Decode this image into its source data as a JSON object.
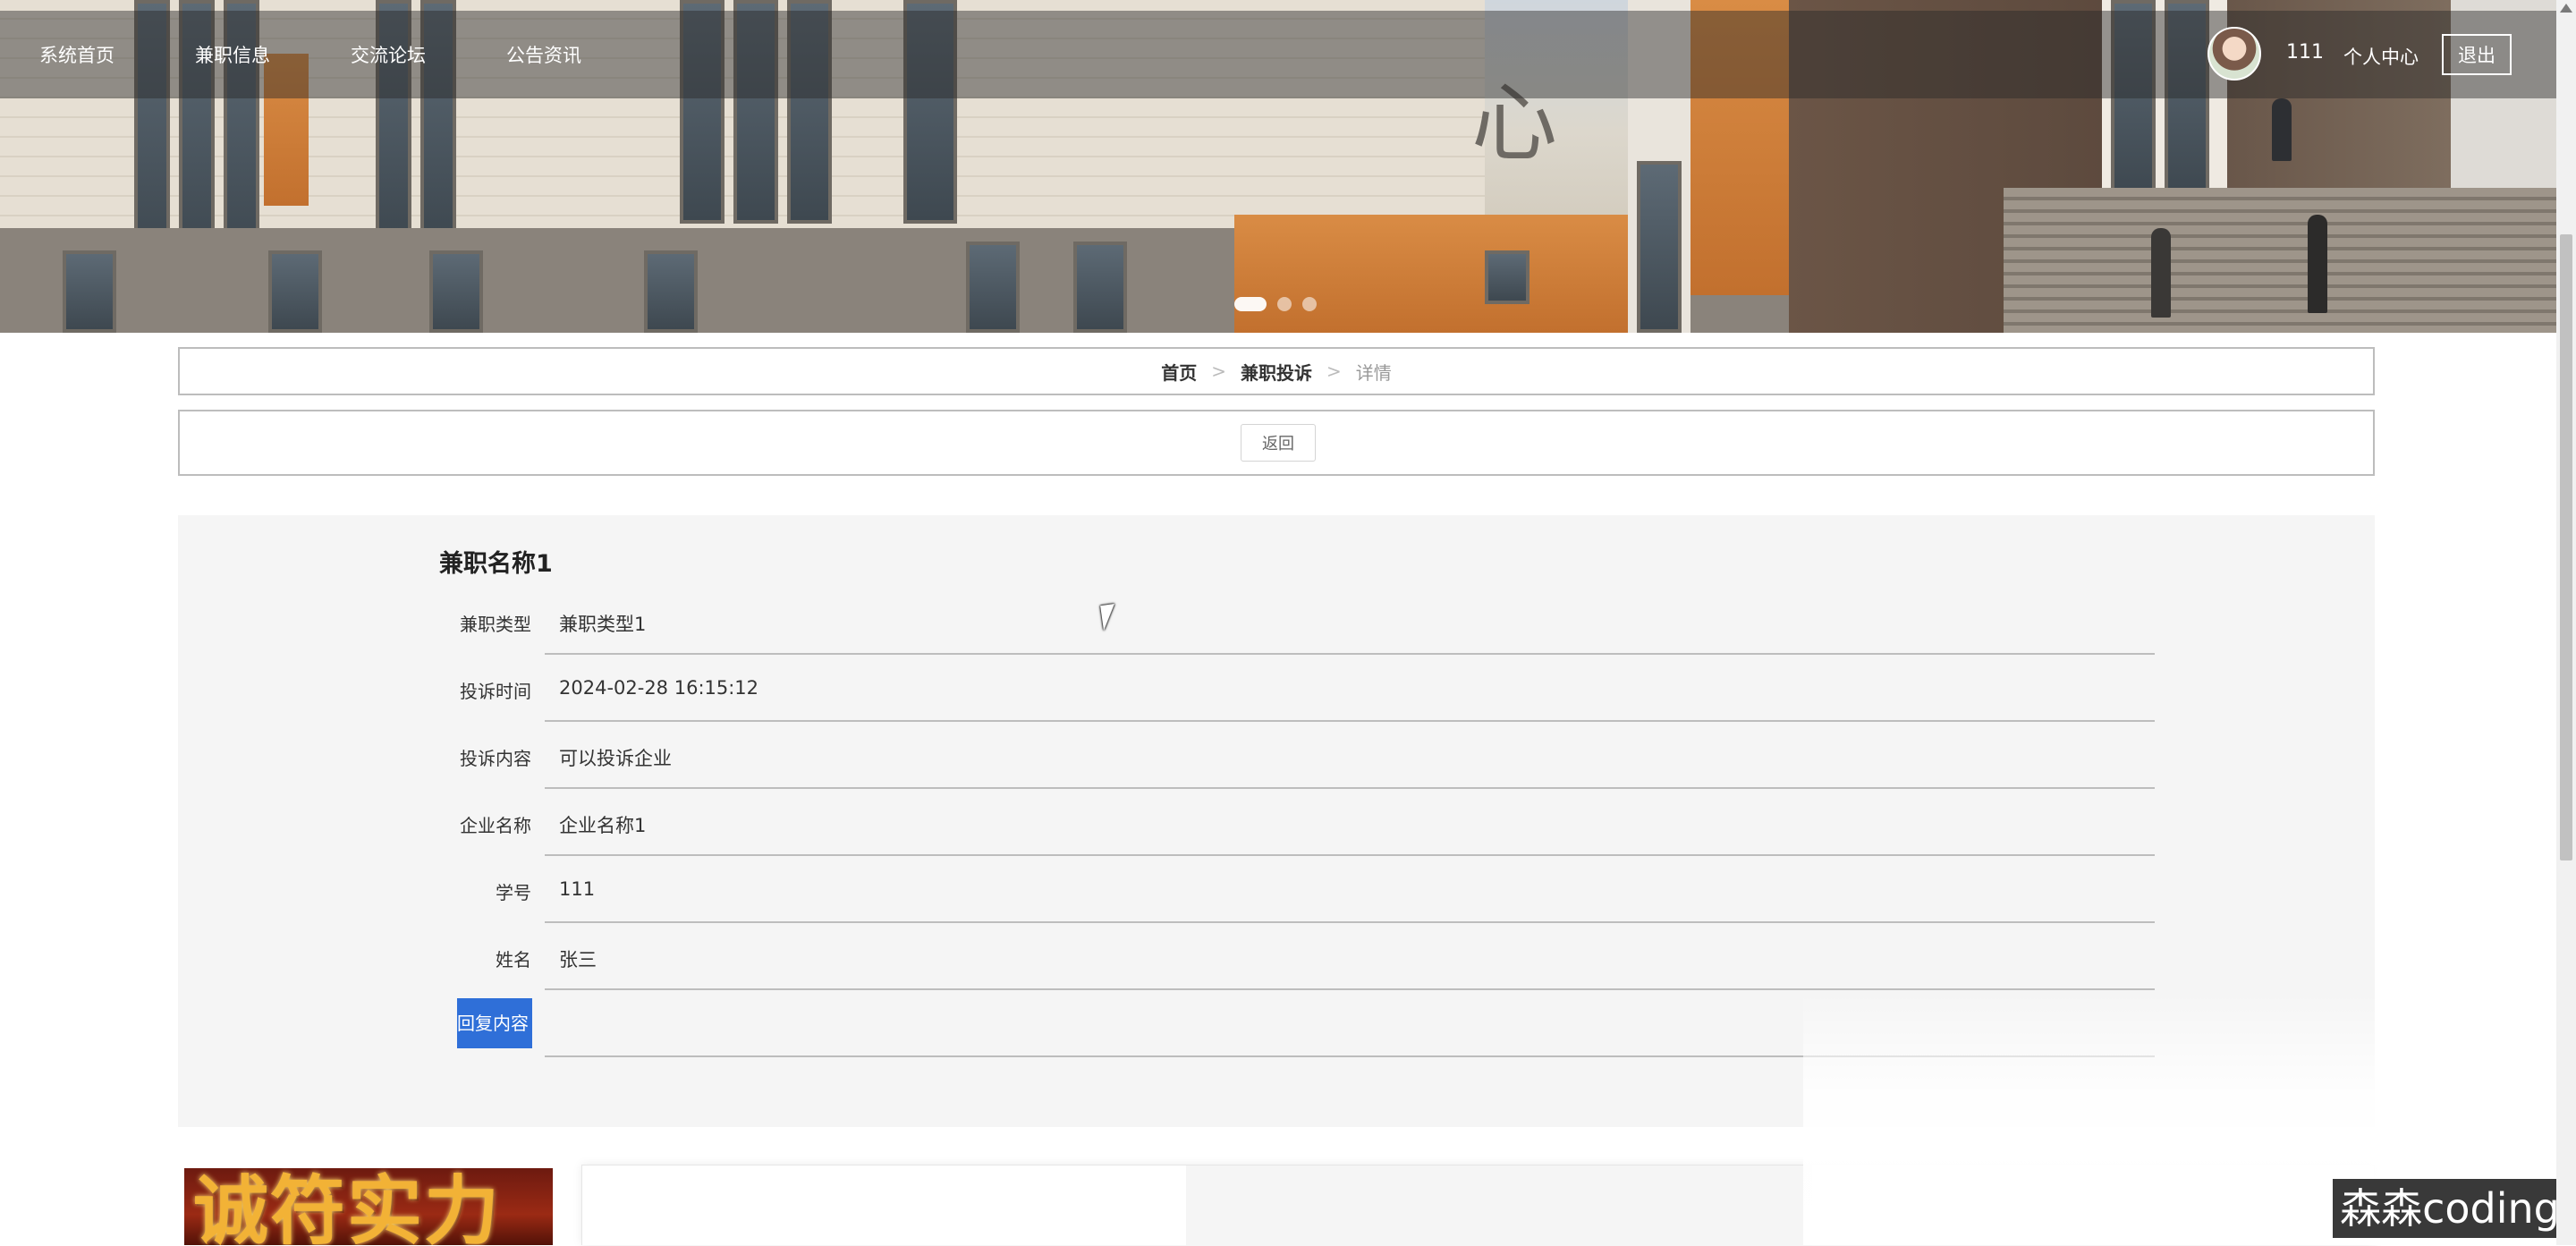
{
  "nav": {
    "items": [
      "系统首页",
      "兼职信息",
      "交流论坛",
      "公告资讯"
    ],
    "username": "111",
    "personal_center": "个人中心",
    "logout": "退出"
  },
  "breadcrumb": {
    "home": "首页",
    "section": "兼职投诉",
    "current": "详情",
    "separator": ">"
  },
  "actions": {
    "back": "返回"
  },
  "detail": {
    "title": "兼职名称1",
    "fields": [
      {
        "label": "兼职类型",
        "value": "兼职类型1"
      },
      {
        "label": "投诉时间",
        "value": "2024-02-28 16:15:12"
      },
      {
        "label": "投诉内容",
        "value": "可以投诉企业"
      },
      {
        "label": "企业名称",
        "value": "企业名称1"
      },
      {
        "label": "学号",
        "value": "111"
      },
      {
        "label": "姓名",
        "value": "张三"
      },
      {
        "label": "回复内容",
        "value": ""
      }
    ]
  },
  "banner": {
    "slides": 3,
    "active_slide": 1
  },
  "watermark": "森森coding",
  "colors": {
    "highlight": "#2f6fd8",
    "panel_bg": "#f5f5f5",
    "border": "#bdbdbd"
  }
}
